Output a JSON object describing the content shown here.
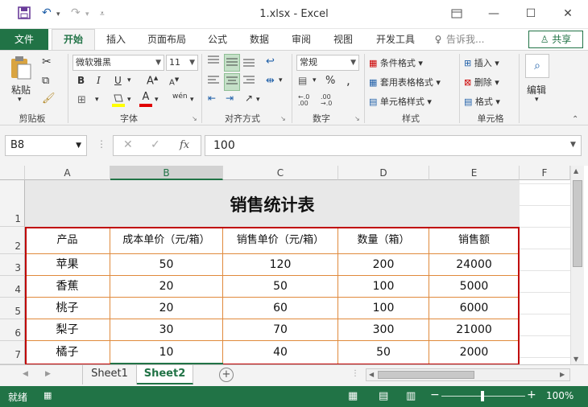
{
  "window": {
    "title": "1.xlsx - Excel",
    "quick_access": {
      "save_icon": "save-icon",
      "undo_icon": "undo-icon",
      "redo_icon": "redo-icon"
    }
  },
  "menu": {
    "file": "文件",
    "tabs": [
      "开始",
      "插入",
      "页面布局",
      "公式",
      "数据",
      "审阅",
      "视图",
      "开发工具"
    ],
    "tell_me": "告诉我...",
    "share": "共享"
  },
  "ribbon": {
    "clipboard": {
      "paste": "粘贴",
      "label": "剪贴板"
    },
    "font": {
      "name": "微软雅黑",
      "size": "11",
      "label": "字体",
      "bold": "B",
      "italic": "I",
      "underline": "U",
      "grow": "A",
      "shrink": "A",
      "font_color": "A",
      "phonetic": "wén"
    },
    "alignment": {
      "label": "对齐方式"
    },
    "number": {
      "format": "常规",
      "label": "数字",
      "percent": "%",
      "comma": ","
    },
    "styles": {
      "conditional": "条件格式",
      "table": "套用表格格式",
      "cell_styles": "单元格样式",
      "label": "样式"
    },
    "cells": {
      "insert": "插入",
      "delete": "删除",
      "format": "格式",
      "label": "单元格"
    },
    "editing": {
      "label": "编辑"
    }
  },
  "formula_bar": {
    "name_box": "B8",
    "fx": "fx",
    "value": "100"
  },
  "sheet": {
    "columns": [
      "A",
      "B",
      "C",
      "D",
      "E",
      "F"
    ],
    "selected_column": "B",
    "rows": [
      "1",
      "2",
      "3",
      "4",
      "5",
      "6",
      "7"
    ],
    "title": "销售统计表",
    "headers": [
      "产品",
      "成本单价（元/箱）",
      "销售单价（元/箱）",
      "数量（箱）",
      "销售额"
    ],
    "data": [
      [
        "苹果",
        "50",
        "120",
        "200",
        "24000"
      ],
      [
        "香蕉",
        "20",
        "50",
        "100",
        "5000"
      ],
      [
        "桃子",
        "20",
        "60",
        "100",
        "6000"
      ],
      [
        "梨子",
        "30",
        "70",
        "300",
        "21000"
      ],
      [
        "橘子",
        "10",
        "40",
        "50",
        "2000"
      ]
    ]
  },
  "sheet_tabs": [
    "Sheet1",
    "Sheet2"
  ],
  "active_sheet": "Sheet2",
  "status": {
    "ready": "就绪",
    "zoom": "100%"
  },
  "colors": {
    "accent": "#217346",
    "highlight_border": "#c00000",
    "cell_border": "#e08a3c"
  }
}
